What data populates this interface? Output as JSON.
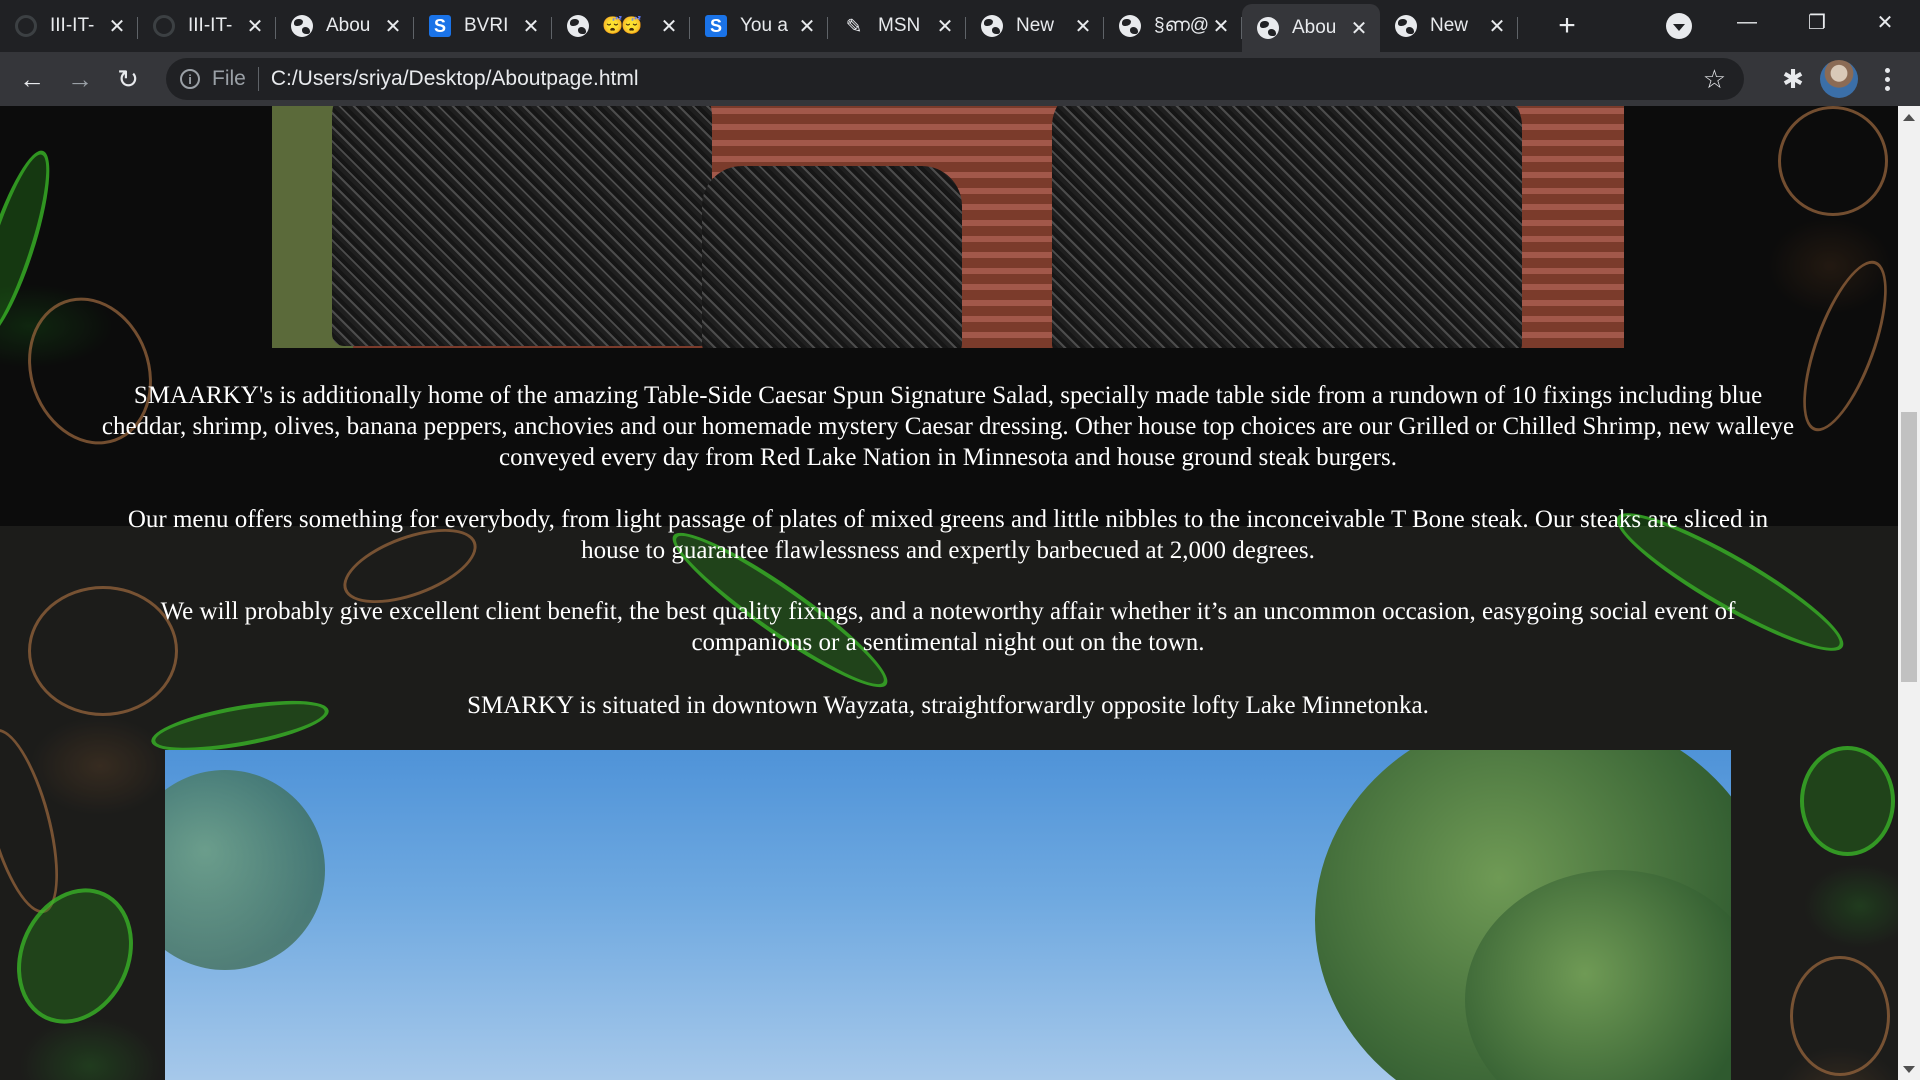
{
  "browser": {
    "tabs": [
      {
        "title": "III-IT-",
        "favicon": "github-icon"
      },
      {
        "title": "III-IT-",
        "favicon": "github-icon"
      },
      {
        "title": "Abou",
        "favicon": "globe-icon"
      },
      {
        "title": "BVRI",
        "favicon": "s-icon"
      },
      {
        "title": "😴😴",
        "favicon": "globe-icon"
      },
      {
        "title": "You a",
        "favicon": "s-icon"
      },
      {
        "title": "MSN",
        "favicon": "msn-icon"
      },
      {
        "title": "New",
        "favicon": "globe-icon"
      },
      {
        "title": "§ണ@",
        "favicon": "globe-icon"
      },
      {
        "title": "Abou",
        "favicon": "globe-icon",
        "active": true
      },
      {
        "title": "New",
        "favicon": "globe-icon"
      }
    ],
    "close_glyph": "✕",
    "new_tab_glyph": "+",
    "address": {
      "scheme_label": "File",
      "url": "C:/Users/sriya/Desktop/Aboutpage.html"
    },
    "window": {
      "minimize": "—",
      "restore": "❐",
      "close": "✕"
    },
    "nav": {
      "back": "←",
      "forward": "→",
      "reload": "↻"
    },
    "star_glyph": "☆",
    "extensions_glyph": "✱"
  },
  "page": {
    "paragraphs": [
      "SMAARKY's is additionally home of the amazing Table-Side Caesar Spun Signature Salad, specially made table side from a rundown of 10 fixings including blue cheddar, shrimp, olives, banana peppers, anchovies and our homemade mystery Caesar dressing. Other house top choices are our Grilled or Chilled Shrimp, new walleye conveyed every day from Red Lake Nation in Minnesota and house ground steak burgers.",
      "Our menu offers something for everybody, from light passage of plates of mixed greens and little nibbles to the inconceivable T Bone steak. Our steaks are sliced in house to guarantee flawlessness and expertly barbecued at 2,000 degrees.",
      "We will probably give excellent client benefit, the best quality fixings, and a noteworthy affair whether it’s an uncommon occasion, easygoing social event of companions or a sentimental night out on the town.",
      "SMARKY is situated in downtown Wayzata, straightforwardly opposite lofty Lake Minnetonka."
    ]
  }
}
